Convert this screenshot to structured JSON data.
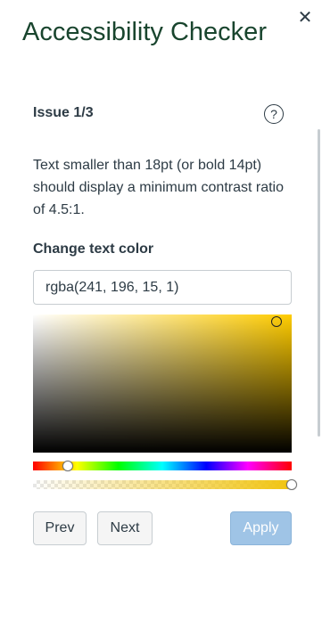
{
  "panel": {
    "title": "Accessibility Checker",
    "close_icon": "close-icon"
  },
  "issue": {
    "counter": "Issue 1/3",
    "help_icon_glyph": "?",
    "message": "Text smaller than 18pt (or bold 14pt) should display a minimum contrast ratio of 4.5:1."
  },
  "color_picker": {
    "label": "Change text color",
    "value": "rgba(241, 196, 15, 1)",
    "base_color": "#f1c40f",
    "hue_degrees": 48,
    "saturation": 0.94,
    "brightness": 0.95,
    "alpha": 1
  },
  "buttons": {
    "prev": "Prev",
    "next": "Next",
    "apply": "Apply",
    "apply_disabled": true
  },
  "colors": {
    "title": "#19452e",
    "text": "#2d3b45",
    "apply_bg": "#9fc4e6"
  }
}
